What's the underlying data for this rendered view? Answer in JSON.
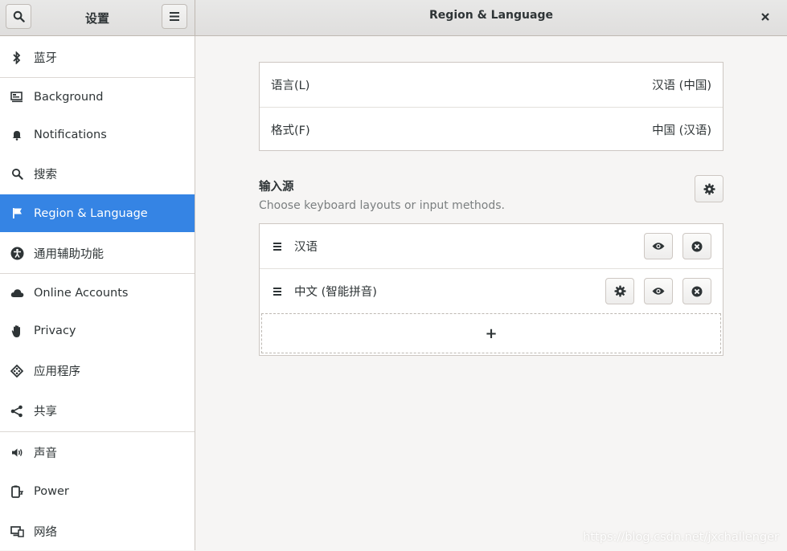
{
  "header": {
    "left_title": "设置",
    "right_title": "Region & Language"
  },
  "sidebar": {
    "items": [
      {
        "label": "蓝牙",
        "icon": "bluetooth-icon"
      },
      {
        "label": "Background",
        "icon": "background-icon"
      },
      {
        "label": "Notifications",
        "icon": "bell-icon"
      },
      {
        "label": "搜索",
        "icon": "search-icon"
      },
      {
        "label": "Region & Language",
        "icon": "flag-icon",
        "active": true
      },
      {
        "label": "通用辅助功能",
        "icon": "accessibility-icon"
      },
      {
        "label": "Online Accounts",
        "icon": "cloud-icon"
      },
      {
        "label": "Privacy",
        "icon": "hand-icon"
      },
      {
        "label": "应用程序",
        "icon": "applications-icon"
      },
      {
        "label": "共享",
        "icon": "share-icon"
      },
      {
        "label": "声音",
        "icon": "speaker-icon"
      },
      {
        "label": "Power",
        "icon": "power-icon"
      },
      {
        "label": "网络",
        "icon": "network-icon"
      }
    ]
  },
  "main": {
    "language": {
      "label": "语言(L)",
      "value": "汉语 (中国)"
    },
    "formats": {
      "label": "格式(F)",
      "value": "中国 (汉语)"
    },
    "input_sources": {
      "title": "输入源",
      "subtitle": "Choose keyboard layouts or input methods.",
      "items": [
        {
          "label": "汉语"
        },
        {
          "label": "中文 (智能拼音)"
        }
      ],
      "add_label": "+"
    }
  },
  "watermark": "https://blog.csdn.net/jxchallenger",
  "colors": {
    "accent": "#3584e4",
    "background": "#f6f5f4"
  }
}
